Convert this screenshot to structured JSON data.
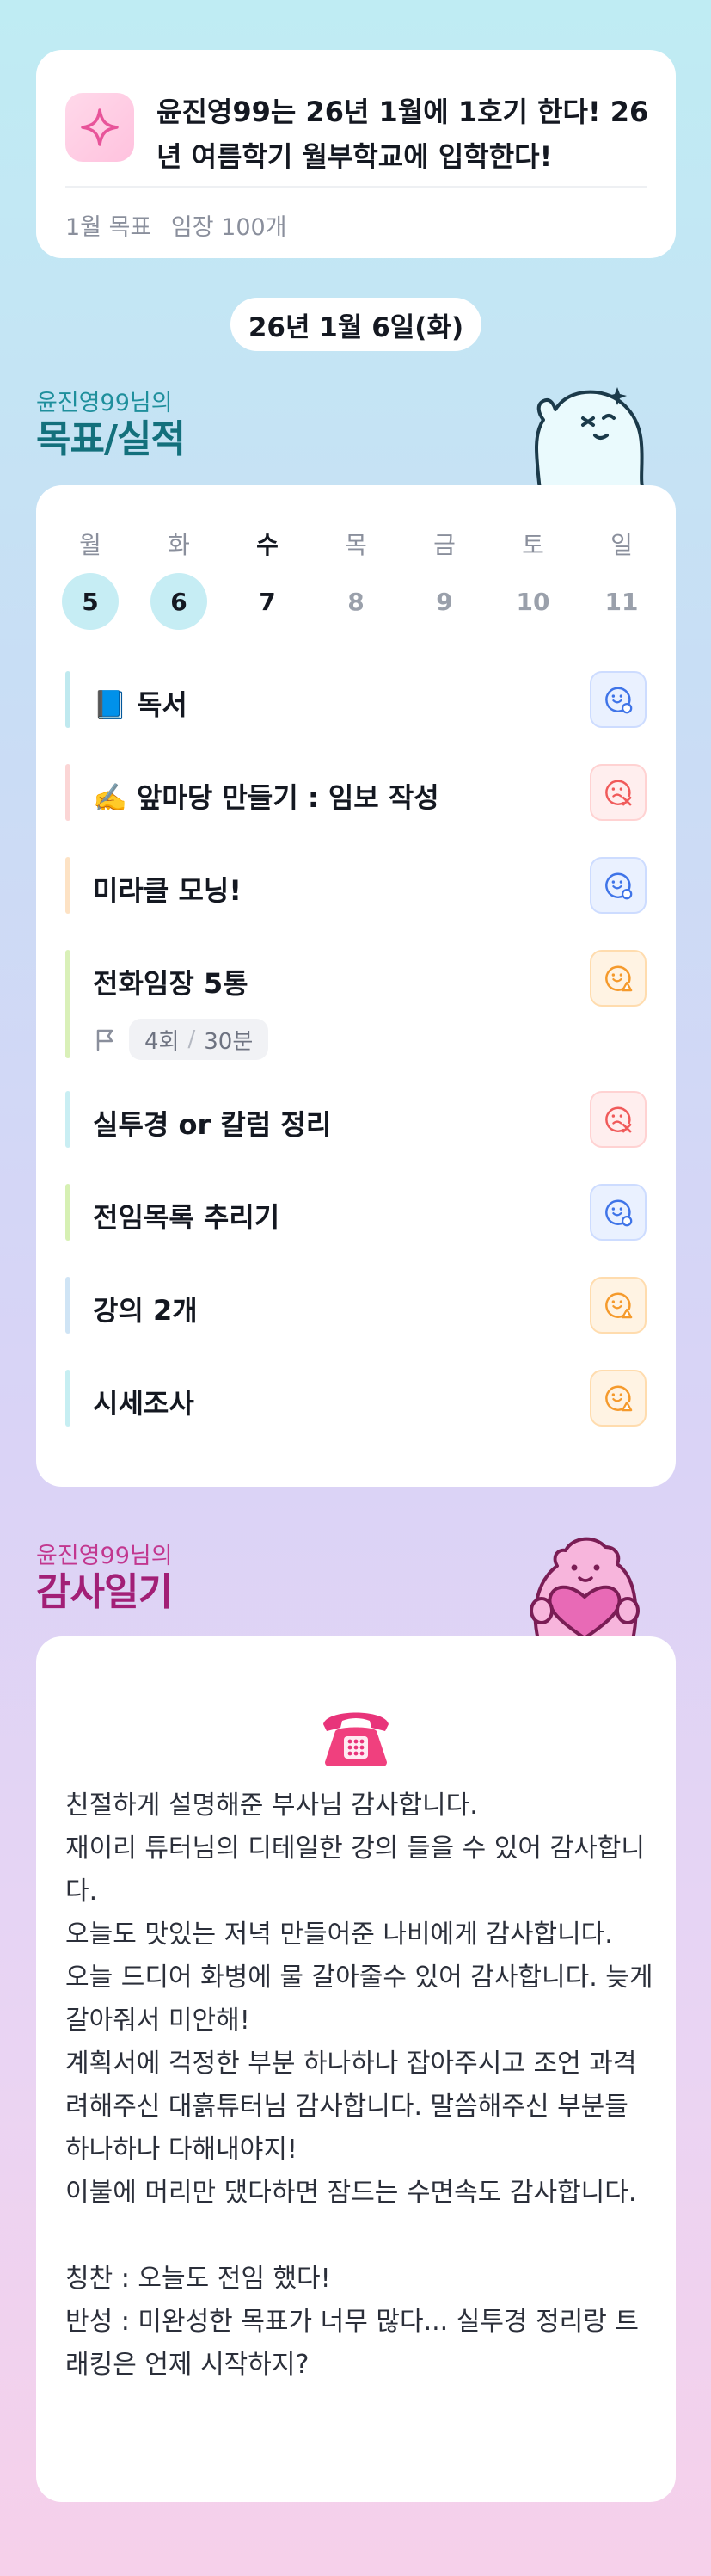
{
  "goal_card": {
    "title": "윤진영99는 26년 1월에 1호기 한다! 26년 여름학기 월부학교에 입학한다!",
    "month_goal_label": "1월 목표",
    "month_goal_value": "임장 100개",
    "icon": "sparkle-icon"
  },
  "date": "26년 1월 6일(화)",
  "goals_section": {
    "owner": "윤진영99님의",
    "title": "목표/실적"
  },
  "week": [
    {
      "name": "월",
      "num": "5",
      "state": "done"
    },
    {
      "name": "화",
      "num": "6",
      "state": "done"
    },
    {
      "name": "수",
      "num": "7",
      "state": "today"
    },
    {
      "name": "목",
      "num": "8",
      "state": "future"
    },
    {
      "name": "금",
      "num": "9",
      "state": "future"
    },
    {
      "name": "토",
      "num": "10",
      "state": "future"
    },
    {
      "name": "일",
      "num": "11",
      "state": "future"
    }
  ],
  "tasks": [
    {
      "label": "📘 독서",
      "status": "done",
      "bar_color": "#bfe9ef"
    },
    {
      "label": "✍️ 앞마당 만들기 : 임보 작성",
      "status": "fail",
      "bar_color": "#fbd5d5"
    },
    {
      "label": "미라클 모닝!",
      "status": "done",
      "bar_color": "#fde2c4"
    },
    {
      "label": "전화임장 5통",
      "status": "partial",
      "bar_color": "#d9f0b8",
      "detail": {
        "count": "4회",
        "duration": "30분"
      }
    },
    {
      "label": "실투경 or 칼럼 정리",
      "status": "fail",
      "bar_color": "#c9eef3"
    },
    {
      "label": "전임목록 추리기",
      "status": "done",
      "bar_color": "#d6f0b3"
    },
    {
      "label": "강의 2개",
      "status": "partial",
      "bar_color": "#cfe4f5"
    },
    {
      "label": "시세조사",
      "status": "partial",
      "bar_color": "#c6eef2"
    }
  ],
  "status_colors": {
    "done": "#3f74e8",
    "fail": "#f05a5a",
    "partial": "#f59a2c"
  },
  "thanks_section": {
    "owner": "윤진영99님의",
    "title": "감사일기",
    "icon": "telephone-icon",
    "body": "친절하게 설명해준 부사님 감사합니다.\n재이리 튜터님의 디테일한 강의 들을 수 있어 감사합니다.\n오늘도 맛있는 저녁 만들어준 나비에게 감사합니다.\n오늘 드디어 화병에 물 갈아줄수 있어 감사합니다. 늦게 갈아줘서 미안해!\n계획서에 걱정한 부분 하나하나 잡아주시고 조언 과격려해주신 대흙튜터님 감사합니다. 말씀해주신 부분들 하나하나 다해내야지!\n이불에 머리만 댔다하면 잠드는 수면속도 감사합니다.\n\n칭찬 : 오늘도 전임 했다!\n반성 : 미완성한 목표가 너무 많다... 실투경 정리랑 트래킹은 언제 시작하지?"
  }
}
